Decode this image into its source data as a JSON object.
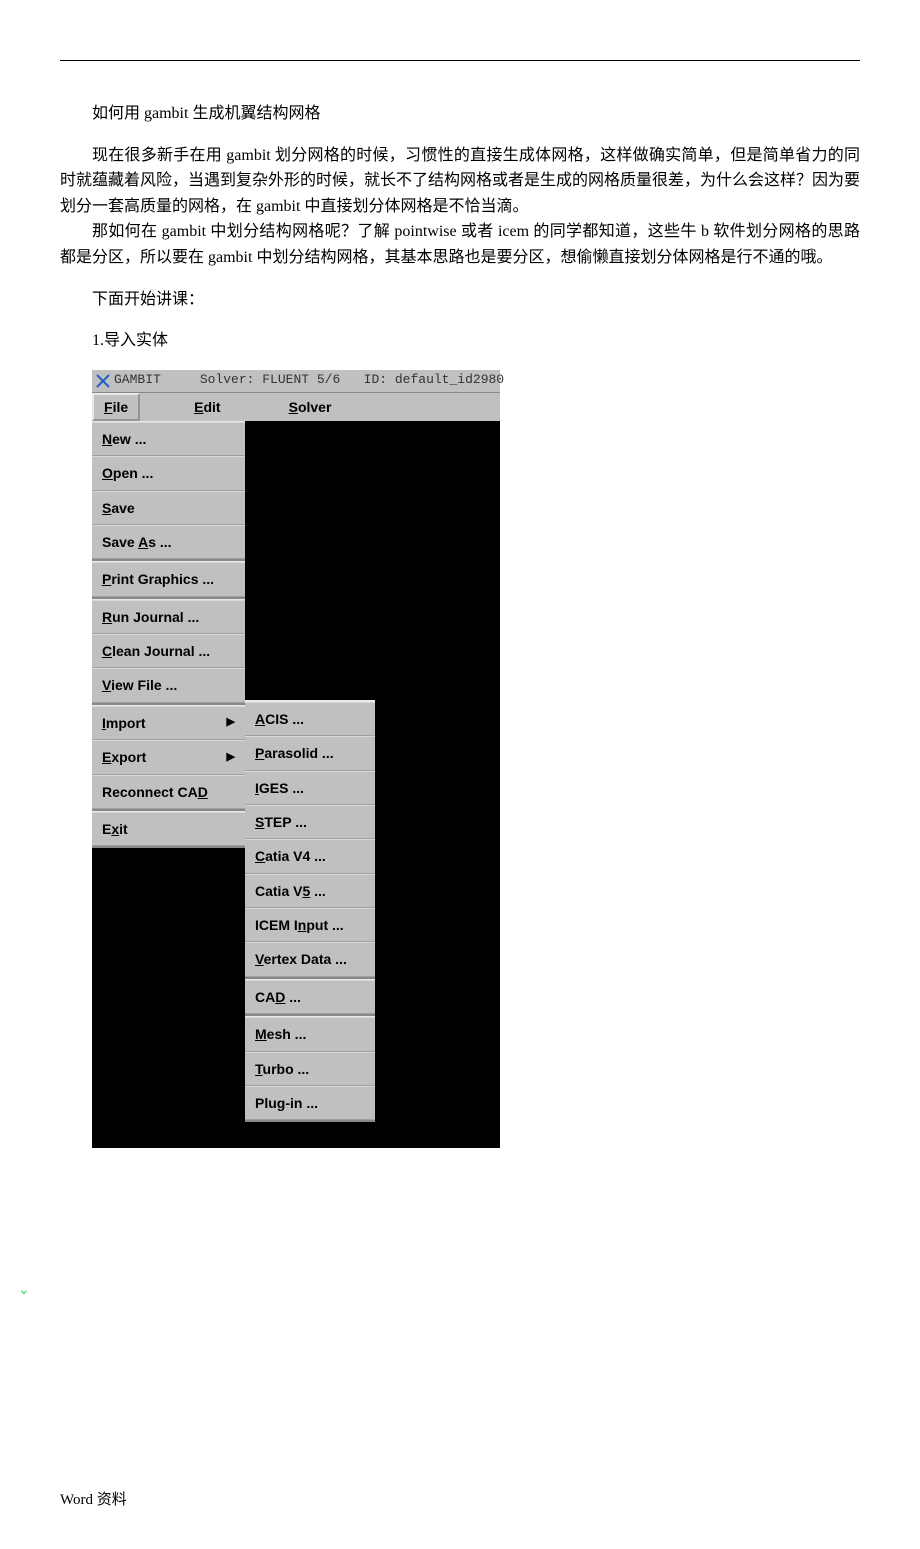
{
  "doc": {
    "title": "如何用 gambit 生成机翼结构网格",
    "p1": "现在很多新手在用 gambit 划分网格的时候，习惯性的直接生成体网格，这样做确实简单，但是简单省力的同时就蕴藏着风险，当遇到复杂外形的时候，就长不了结构网格或者是生成的网格质量很差，为什么会这样？因为要划分一套高质量的网格，在 gambit 中直接划分体网格是不恰当滴。",
    "p2": "那如何在 gambit 中划分结构网格呢？了解 pointwise 或者 icem 的同学都知道，这些牛 b 软件划分网格的思路都是分区，所以要在 gambit 中划分结构网格，其基本思路也是要分区，想偷懒直接划分体网格是行不通的哦。",
    "line3": "下面开始讲课：",
    "line4": "1.导入实体",
    "footer": "Word  资料"
  },
  "gambit": {
    "title_app": "GAMBIT",
    "title_solver": "Solver: FLUENT 5/6",
    "title_id": "ID: default_id2980",
    "menubar": {
      "file": "File",
      "edit": "Edit",
      "solver": "Solver"
    },
    "file_menu": {
      "g1": [
        "New ...",
        "Open ...",
        "Save",
        "Save As ..."
      ],
      "g2": [
        "Print Graphics ..."
      ],
      "g3": [
        "Run Journal ...",
        "Clean Journal ...",
        "View File ..."
      ],
      "g4": [
        {
          "label": "Import",
          "arrow": true
        },
        {
          "label": "Export",
          "arrow": true
        },
        {
          "label": "Reconnect CAD",
          "arrow": false
        }
      ],
      "g5": [
        "Exit"
      ]
    },
    "import_menu": {
      "g1": [
        "ACIS ...",
        "Parasolid ...",
        "IGES ...",
        "STEP ...",
        "Catia V4 ...",
        "Catia V5 ...",
        "ICEM Input ...",
        "Vertex Data ..."
      ],
      "g2": [
        "CAD ..."
      ],
      "g3": [
        "Mesh ...",
        "Turbo ...",
        "Plug-in ..."
      ]
    }
  }
}
